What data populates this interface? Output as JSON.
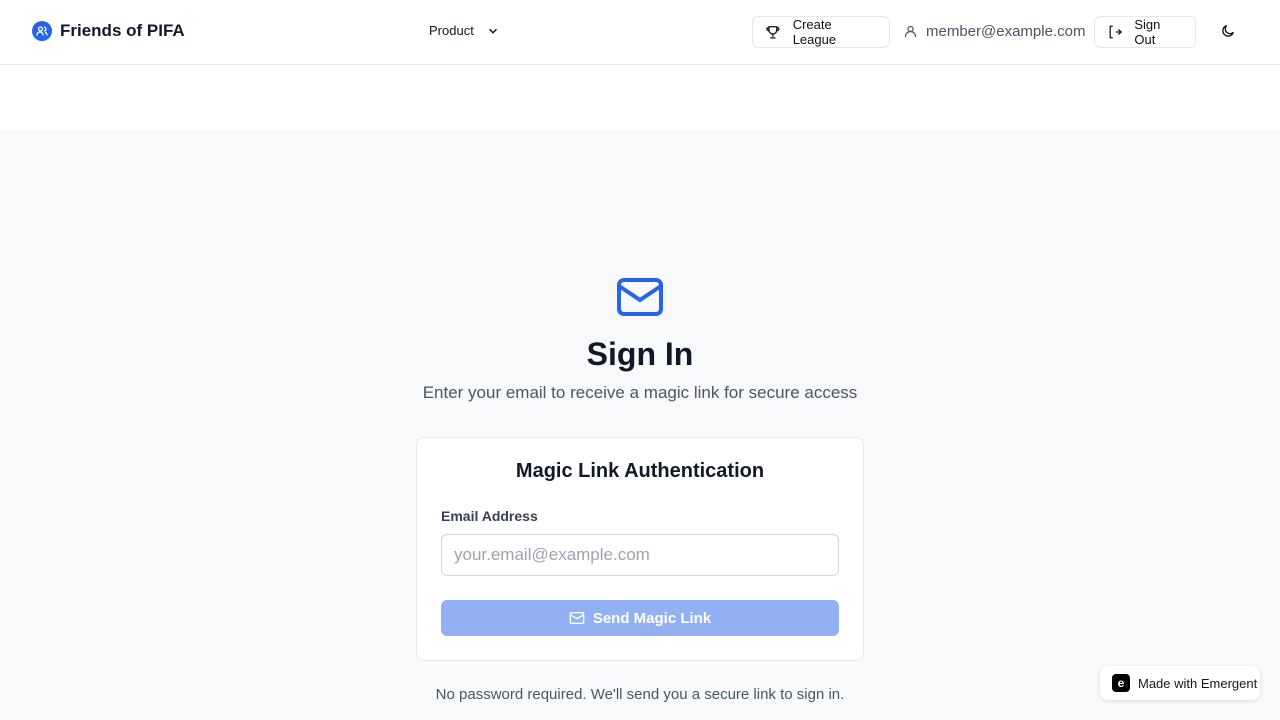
{
  "header": {
    "brand": "Friends of PIFA",
    "product_menu": "Product",
    "create_league": "Create League",
    "user_email": "member@example.com",
    "sign_out": "Sign Out"
  },
  "hero": {
    "title": "Sign In",
    "subtitle": "Enter your email to receive a magic link for secure access"
  },
  "card": {
    "title": "Magic Link Authentication",
    "email_label": "Email Address",
    "email_placeholder": "your.email@example.com",
    "email_value": "",
    "send_button": "Send Magic Link"
  },
  "note": "No password required. We'll send you a secure link to sign in.",
  "badge": {
    "label": "Made with Emergent",
    "icon_letter": "e"
  },
  "colors": {
    "primary": "#2563eb",
    "button_disabled": "#93b0f3"
  }
}
